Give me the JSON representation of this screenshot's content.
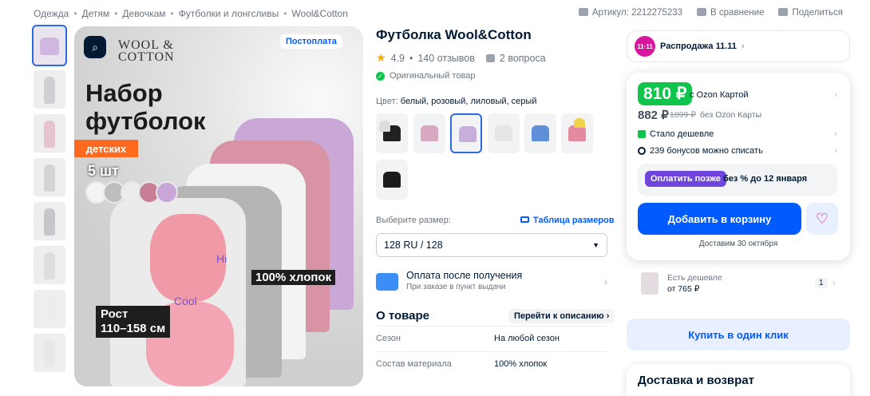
{
  "breadcrumbs": [
    "Одежда",
    "Детям",
    "Девочкам",
    "Футболки и лонгсливы",
    "Wool&Cotton"
  ],
  "top_actions": {
    "article": "Артикул: 2212275233",
    "compare": "В сравнение",
    "share": "Поделиться"
  },
  "hero": {
    "badge": "Постоплата",
    "brand_logo": "WOOL & COTTON",
    "headline_line1": "Набор",
    "headline_line2": "футболок",
    "ribbon": "детских",
    "count": "5 шт",
    "cotton": "100% хлопок",
    "height_line1": "Рост",
    "height_line2": "110–158 см",
    "print_text1": "Hi",
    "print_text2": "Cool",
    "swatch_colors": [
      "#f4f4f4",
      "#bdbdbd",
      "#ececec",
      "#c77f95",
      "#c8a6d8"
    ]
  },
  "product": {
    "title": "Футболка Wool&Cotton",
    "rating": "4.9",
    "reviews": "140 отзывов",
    "questions": "2 вопроса",
    "original": "Оригинальный товар",
    "color_label": "Цвет:",
    "color_value": "белый, розовый, лиловый, серый",
    "size_label": "Выберите размер:",
    "size_table": "Таблица размеров",
    "size_value": "128 RU / 128",
    "pay_title": "Оплата после получения",
    "pay_sub": "При заказе в пункт выдачи",
    "about_title": "О товаре",
    "about_link": "Перейти к описанию",
    "specs": [
      {
        "key": "Сезон",
        "value": "На любой сезон"
      },
      {
        "key": "Состав материала",
        "value": "100% хлопок"
      }
    ]
  },
  "buybox": {
    "sale": "Распродажа 11.11",
    "sale_icon": "11·11",
    "price_card": "810 ₽",
    "price_card_label": "с Ozon Картой",
    "price": "882 ₽",
    "price_old": "1899 ₽",
    "price_nocard": "без Ozon Карты",
    "cheaper": "Стало дешевле",
    "bonus": "239 бонусов можно списать",
    "later_btn": "Оплатить позже",
    "later_text": "без % до 12 января",
    "add_to_cart": "Добавить в корзину",
    "delivery": "Доставим 30 октября",
    "cheaper_title": "Есть дешевле",
    "cheaper_price": "от 765 ₽",
    "cheaper_count": "1",
    "one_click": "Купить в один клик",
    "delivery_header": "Доставка и возврат"
  },
  "colors": {
    "accent": "#005bff",
    "green": "#10c44c",
    "purple": "#7045dd",
    "pink": "#d5108b"
  }
}
